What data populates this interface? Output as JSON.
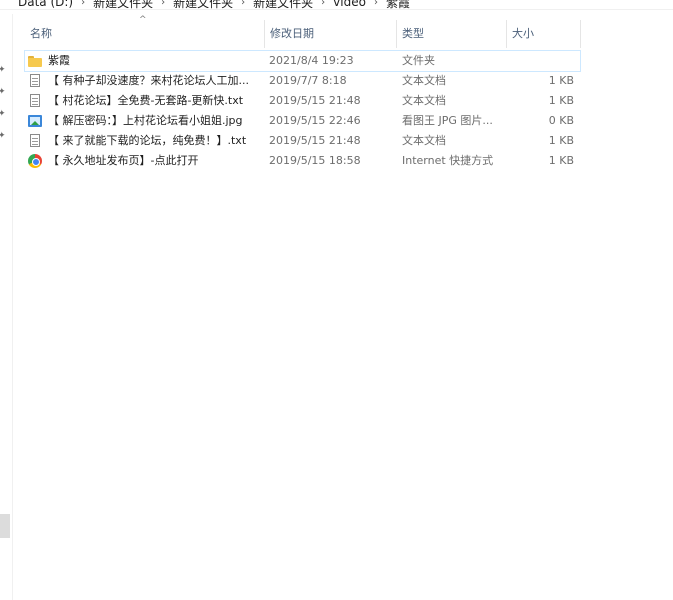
{
  "breadcrumb": [
    "Data (D:)",
    "新建文件夹",
    "新建文件夹",
    "新建文件夹",
    "video",
    "紫霞"
  ],
  "columns": {
    "name": "名称",
    "date": "修改日期",
    "type": "类型",
    "size": "大小"
  },
  "files": [
    {
      "name": "紫霞",
      "date": "2021/8/4 19:23",
      "type": "文件夹",
      "size": "",
      "icon": "folder-icon"
    },
    {
      "name": "【 有种子却没速度？来村花论坛人工加...",
      "date": "2019/7/7 8:18",
      "type": "文本文档",
      "size": "1 KB",
      "icon": "text-file-icon"
    },
    {
      "name": "【 村花论坛】全免费-无套路-更新快.txt",
      "date": "2019/5/15 21:48",
      "type": "文本文档",
      "size": "1 KB",
      "icon": "text-file-icon"
    },
    {
      "name": "【 解压密码：】上村花论坛看小姐姐.jpg",
      "date": "2019/5/15 22:46",
      "type": "看图王 JPG 图片...",
      "size": "0 KB",
      "icon": "image-file-icon"
    },
    {
      "name": "【 来了就能下载的论坛，纯免费！】.txt",
      "date": "2019/5/15 21:48",
      "type": "文本文档",
      "size": "1 KB",
      "icon": "text-file-icon"
    },
    {
      "name": "【 永久地址发布页】-点此打开",
      "date": "2019/5/15 18:58",
      "type": "Internet 快捷方式",
      "size": "1 KB",
      "icon": "internet-shortcut-icon"
    }
  ]
}
